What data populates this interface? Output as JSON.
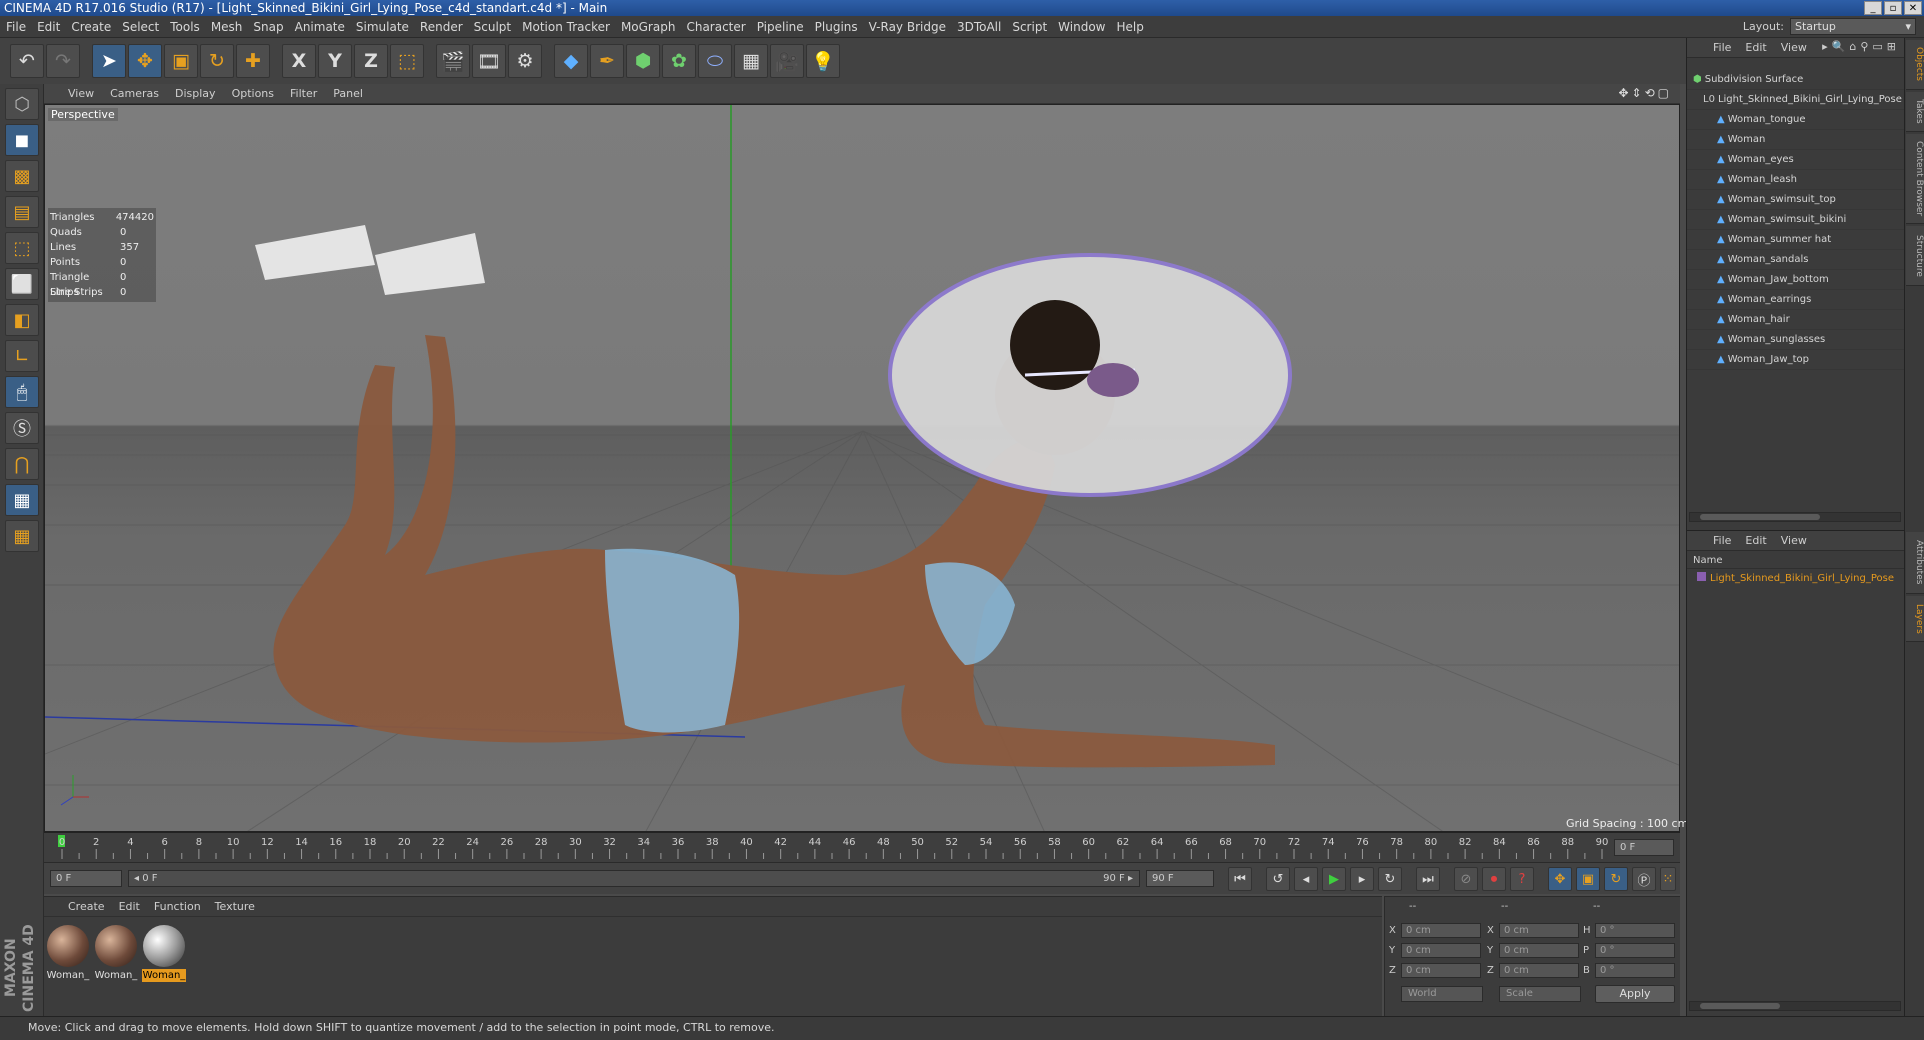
{
  "window": {
    "title": "CINEMA 4D R17.016 Studio (R17) - [Light_Skinned_Bikini_Girl_Lying_Pose_c4d_standart.c4d *] - Main"
  },
  "menu": [
    "File",
    "Edit",
    "Create",
    "Select",
    "Tools",
    "Mesh",
    "Snap",
    "Animate",
    "Simulate",
    "Render",
    "Sculpt",
    "Motion Tracker",
    "MoGraph",
    "Character",
    "Pipeline",
    "Plugins",
    "V-Ray Bridge",
    "3DToAll",
    "Script",
    "Window",
    "Help"
  ],
  "layout": {
    "label": "Layout:",
    "value": "Startup"
  },
  "toolbar": {
    "axis_x": "X",
    "axis_y": "Y",
    "axis_z": "Z"
  },
  "viewport": {
    "menu": [
      "View",
      "Cameras",
      "Display",
      "Options",
      "Filter",
      "Panel"
    ],
    "label": "Perspective",
    "grid_spacing": "Grid Spacing : 100 cm",
    "stats": [
      {
        "k": "Triangles",
        "v": "474420"
      },
      {
        "k": "Quads",
        "v": "0"
      },
      {
        "k": "Lines",
        "v": "357"
      },
      {
        "k": "Points",
        "v": "0"
      },
      {
        "k": "Triangle Strips",
        "v": "0"
      },
      {
        "k": "Line Strips",
        "v": "0"
      }
    ]
  },
  "timeline": {
    "ticks": [
      "0",
      "2",
      "4",
      "6",
      "8",
      "10",
      "12",
      "14",
      "16",
      "18",
      "20",
      "22",
      "24",
      "26",
      "28",
      "30",
      "32",
      "34",
      "36",
      "38",
      "40",
      "42",
      "44",
      "46",
      "48",
      "50",
      "52",
      "54",
      "56",
      "58",
      "60",
      "62",
      "64",
      "66",
      "68",
      "70",
      "72",
      "74",
      "76",
      "78",
      "80",
      "82",
      "84",
      "86",
      "88",
      "90"
    ],
    "current_frame": "0 F"
  },
  "playback": {
    "start": "0 F",
    "range_start": "◂ 0 F",
    "range_end": "90 F ▸",
    "end": "90 F"
  },
  "materials": {
    "menu": [
      "Create",
      "Edit",
      "Function",
      "Texture"
    ],
    "items": [
      {
        "label": "Woman_"
      },
      {
        "label": "Woman_"
      },
      {
        "label": "Woman_"
      }
    ]
  },
  "coordinates": {
    "header": [
      "--",
      "--",
      "--"
    ],
    "rows": [
      {
        "a": "X",
        "av": "0 cm",
        "b": "X",
        "bv": "0 cm",
        "c": "H",
        "cv": "0 °"
      },
      {
        "a": "Y",
        "av": "0 cm",
        "b": "Y",
        "bv": "0 cm",
        "c": "P",
        "cv": "0 °"
      },
      {
        "a": "Z",
        "av": "0 cm",
        "b": "Z",
        "bv": "0 cm",
        "c": "B",
        "cv": "0 °"
      }
    ],
    "mode1": "World",
    "mode2": "Scale",
    "apply": "Apply"
  },
  "logo": {
    "text": "MAXON CINEMA 4D"
  },
  "status": "Move: Click and drag to move elements. Hold down SHIFT to quantize movement / add to the selection in point mode, CTRL to remove.",
  "objects": {
    "menu": [
      "File",
      "Edit",
      "View"
    ],
    "root": "Subdivision Surface",
    "group": "Light_Skinned_Bikini_Girl_Lying_Pose",
    "children": [
      "Woman_tongue",
      "Woman",
      "Woman_eyes",
      "Woman_leash",
      "Woman_swimsuit_top",
      "Woman_swimsuit_bikini",
      "Woman_summer hat",
      "Woman_sandals",
      "Woman_Jaw_bottom",
      "Woman_earrings",
      "Woman_hair",
      "Woman_sunglasses",
      "Woman_Jaw_top"
    ]
  },
  "layers": {
    "menu": [
      "File",
      "Edit",
      "View"
    ],
    "name_header": "Name",
    "row": "Light_Skinned_Bikini_Girl_Lying_Pose"
  },
  "side_tabs": [
    "Objects",
    "Takes",
    "Content Browser",
    "Structure",
    "Attributes",
    "Layers"
  ],
  "colors": {
    "accent": "#e69a1e",
    "selection": "#3a5f86",
    "background": "#4a4a4a"
  }
}
